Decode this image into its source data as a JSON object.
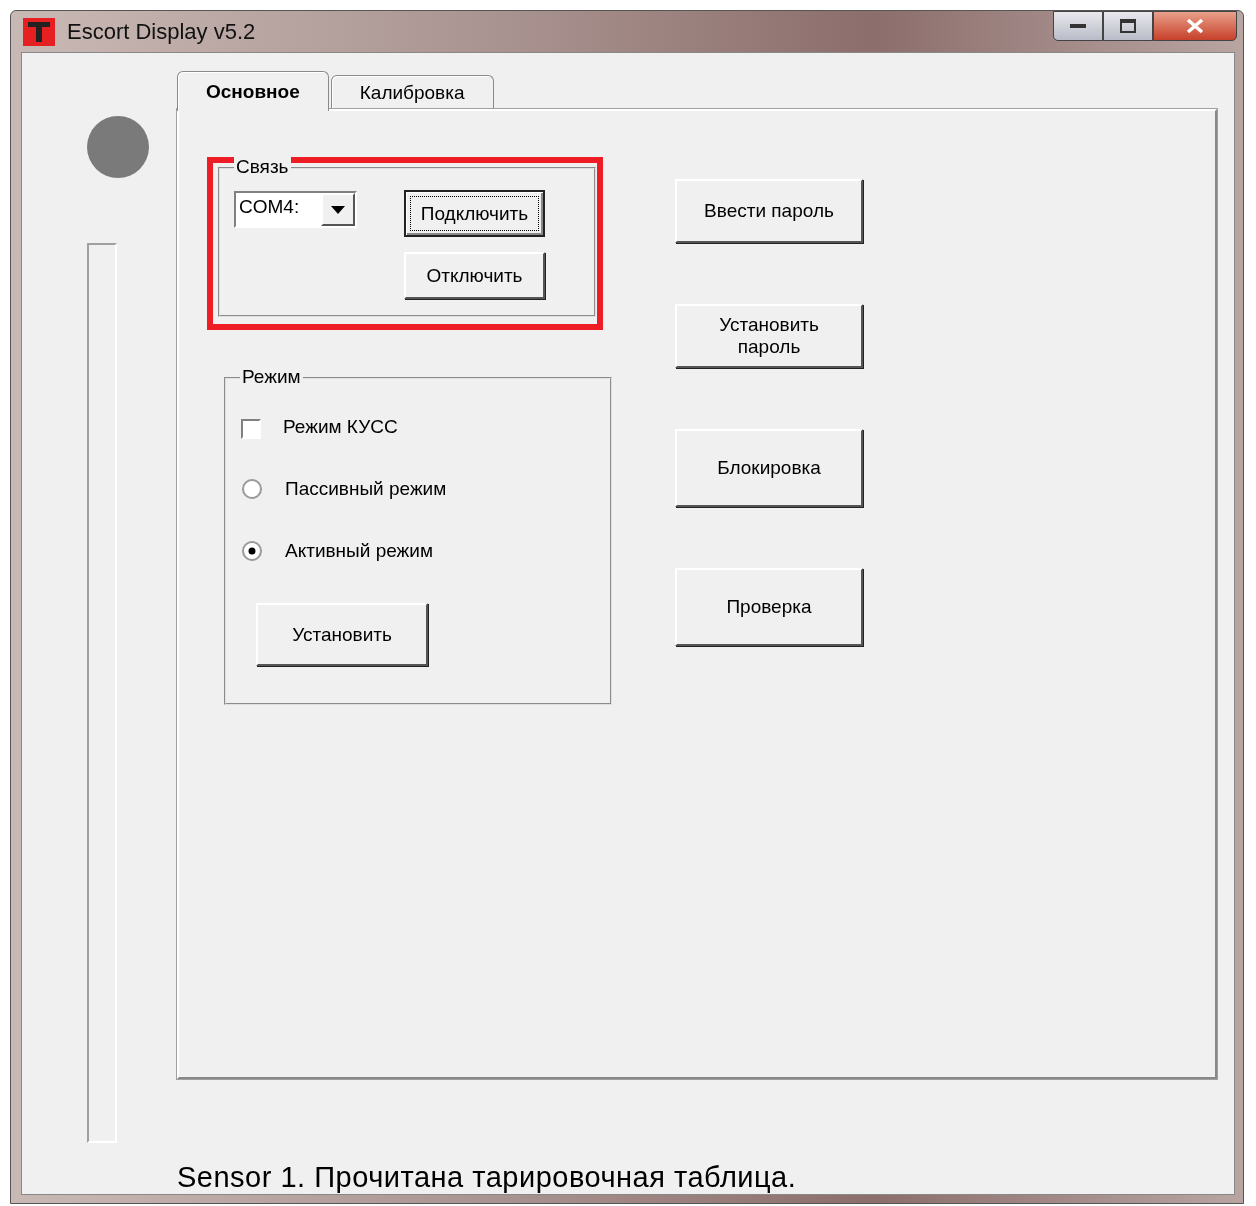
{
  "window": {
    "title": "Escort Display v5.2"
  },
  "tabs": [
    {
      "label": "Основное",
      "selected": true
    },
    {
      "label": "Калибровка",
      "selected": false
    }
  ],
  "connection": {
    "title": "Связь",
    "highlighted": true,
    "port": "COM4:",
    "buttons": [
      {
        "label": "Подключить",
        "focused": true
      },
      {
        "label": "Отключить",
        "focused": false
      }
    ]
  },
  "mode": {
    "title": "Режим",
    "options": [
      {
        "kind": "checkbox",
        "label": "Режим КУСС",
        "checked": false
      },
      {
        "kind": "radio",
        "label": "Пассивный режим",
        "selected": false
      },
      {
        "kind": "radio",
        "label": "Активный режим",
        "selected": true
      }
    ],
    "apply_button": "Установить"
  },
  "signal_bar": {
    "level": 0
  },
  "actions": [
    "Ввести пароль",
    "Установить пароль",
    "Блокировка",
    "Проверка"
  ],
  "status": "Sensor 1. Прочитана тарировочная таблица."
}
